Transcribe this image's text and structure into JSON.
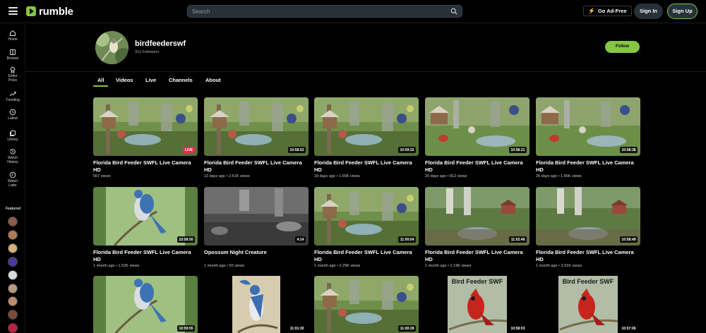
{
  "header": {
    "logo_text": "rumble",
    "search_placeholder": "Search",
    "adfree_label": "Go Ad-Free",
    "signin_label": "Sign In",
    "signup_label": "Sign Up",
    "accent_color": "#85c742"
  },
  "sidebar": {
    "items": [
      {
        "label": "Home",
        "icon": "home-icon"
      },
      {
        "label": "Browse",
        "icon": "browse-icon"
      },
      {
        "label": "Editor Picks",
        "icon": "award-icon"
      },
      {
        "label": "Trending",
        "icon": "trending-icon"
      },
      {
        "label": "Latest",
        "icon": "clock-icon"
      },
      {
        "label": "Library",
        "icon": "library-icon"
      },
      {
        "label": "Watch History",
        "icon": "history-icon"
      },
      {
        "label": "Watch Later",
        "icon": "watch-later-icon"
      }
    ],
    "featured_label": "Featured",
    "featured_colors": [
      "#8a5a4a",
      "#b07a55",
      "#d6b07a",
      "#4a3aa0",
      "#d9d9d9",
      "#b89a80",
      "#c08a6a",
      "#7a4a3a",
      "#c02040"
    ]
  },
  "channel": {
    "name": "birdfeederswf",
    "followers": "312 Followers",
    "follow_label": "Follow"
  },
  "tabs": [
    {
      "label": "All",
      "active": true
    },
    {
      "label": "Videos",
      "active": false
    },
    {
      "label": "Live",
      "active": false
    },
    {
      "label": "Channels",
      "active": false
    },
    {
      "label": "About",
      "active": false
    }
  ],
  "videos": [
    {
      "title": "Florida Bird Feeder SWFL Live Camera HD",
      "meta": "567 views",
      "badge": "LIVE",
      "live": true,
      "scene": "feeder"
    },
    {
      "title": "Florida Bird Feeder SWFL Live Camera HD",
      "meta": "13 days ago • 2.61K views",
      "badge": "10:58:52",
      "live": false,
      "scene": "feeder"
    },
    {
      "title": "Florida Bird Feeder SWFL Live Camera HD",
      "meta": "18 days ago • 1.65K views",
      "badge": "10:59:22",
      "live": false,
      "scene": "feeder"
    },
    {
      "title": "Florida Bird Feeder SWFL Live Camera HD",
      "meta": "20 days ago • 812 views",
      "badge": "10:58:21",
      "live": false,
      "scene": "feeder2"
    },
    {
      "title": "Florida Bird Feeder SWFL Live Camera HD",
      "meta": "26 days ago • 1.96K views",
      "badge": "10:58:38",
      "live": false,
      "scene": "feeder2"
    },
    {
      "title": "Florida Bird Feeder SWFL Live Camera HD",
      "meta": "1 month ago • 1.52K views",
      "badge": "10:58:50",
      "live": false,
      "scene": "jay"
    },
    {
      "title": "Opossum Night Creature",
      "meta": "1 month ago • 50 views",
      "badge": "4:14",
      "live": false,
      "scene": "night"
    },
    {
      "title": "Florida Bird Feeder SWFL Live Camera HD",
      "meta": "1 month ago • 2.29K views",
      "badge": "11:00:04",
      "live": false,
      "scene": "feeder"
    },
    {
      "title": "Florida Bird Feeder SWFL Live Camera HD",
      "meta": "1 month ago • 2.19K views",
      "badge": "11:02:46",
      "live": false,
      "scene": "feeder3"
    },
    {
      "title": "Florida Bird Feeder SWFL Live Camera HD",
      "meta": "1 month ago • 3.91K views",
      "badge": "10:58:49",
      "live": false,
      "scene": "feeder3"
    },
    {
      "title": "",
      "meta": "",
      "badge": "10:59:55",
      "live": false,
      "scene": "jay"
    },
    {
      "title": "",
      "meta": "",
      "badge": "11:01:30",
      "live": false,
      "scene": "bluejay"
    },
    {
      "title": "",
      "meta": "",
      "badge": "11:00:28",
      "live": false,
      "scene": "feeder"
    },
    {
      "title": "",
      "meta": "",
      "badge": "10:58:03",
      "live": false,
      "scene": "cardinal",
      "overlay": "Bird Feeder SWF"
    },
    {
      "title": "",
      "meta": "",
      "badge": "10:57:06",
      "live": false,
      "scene": "cardinal",
      "overlay": "Bird Feeder SWF"
    }
  ]
}
